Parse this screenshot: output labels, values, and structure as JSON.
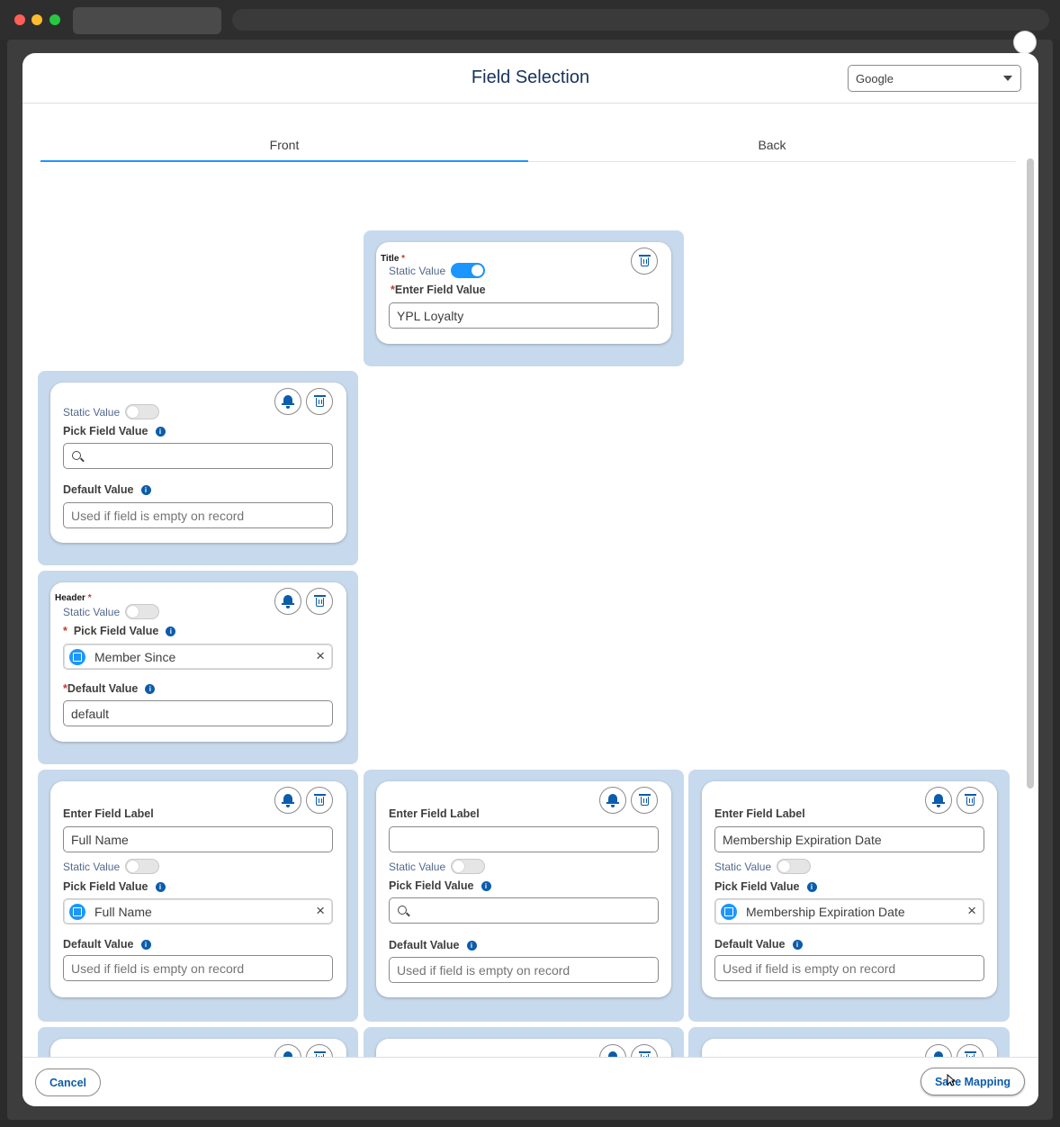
{
  "modal": {
    "title": "Field Selection",
    "platform_select": {
      "value": "Google"
    },
    "tabs": [
      {
        "label": "Front",
        "active": true
      },
      {
        "label": "Back",
        "active": false
      }
    ]
  },
  "labels": {
    "static_value": "Static Value",
    "pick_field_value": "Pick Field Value",
    "default_value": "Default Value",
    "enter_field_label": "Enter Field Label",
    "enter_field_value": "Enter Field Value",
    "default_placeholder": "Used if field is empty on record"
  },
  "cards": {
    "title_card": {
      "tag": "Title",
      "static_value_on": true,
      "field_value": "YPL Loyalty"
    },
    "field_card_1": {
      "static_value_on": false
    },
    "header_card": {
      "tag": "Header",
      "static_value_on": false,
      "picked_field": "Member Since",
      "default_value": "default"
    },
    "row1": [
      {
        "field_label": "Full Name",
        "static_value_on": false,
        "picked_field": "Full Name"
      },
      {
        "field_label": "",
        "static_value_on": false,
        "picked_field": ""
      },
      {
        "field_label": "Membership Expiration Date",
        "static_value_on": false,
        "picked_field": "Membership Expiration Date"
      }
    ]
  },
  "footer": {
    "cancel_label": "Cancel",
    "save_label": "Save Mapping"
  },
  "colors": {
    "accent": "#1b96ff",
    "brand_text": "#0b5cab",
    "slot_bg": "#c7d9ec"
  }
}
